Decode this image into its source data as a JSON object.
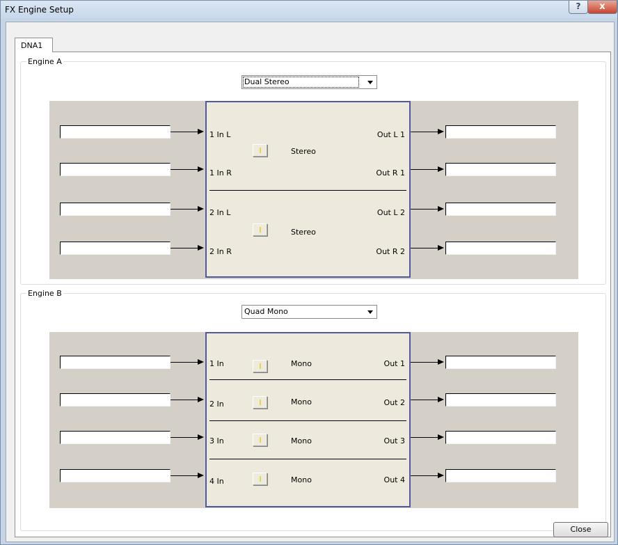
{
  "window": {
    "title": "FX Engine Setup",
    "help_symbol": "?",
    "close_symbol": "x"
  },
  "tabs": [
    {
      "label": "DNA1"
    }
  ],
  "engine_a": {
    "legend": "Engine A",
    "mode": "Dual Stereo",
    "groups": [
      {
        "type_label": "Stereo",
        "inputs": [
          {
            "label": "1 In L",
            "source": ""
          },
          {
            "label": "1 In R",
            "source": ""
          }
        ],
        "outputs": [
          {
            "label": "Out L 1",
            "dest": ""
          },
          {
            "label": "Out R 1",
            "dest": ""
          }
        ]
      },
      {
        "type_label": "Stereo",
        "inputs": [
          {
            "label": "2 In L",
            "source": ""
          },
          {
            "label": "2 In R",
            "source": ""
          }
        ],
        "outputs": [
          {
            "label": "Out L 2",
            "dest": ""
          },
          {
            "label": "Out R 2",
            "dest": ""
          }
        ]
      }
    ]
  },
  "engine_b": {
    "legend": "Engine B",
    "mode": "Quad Mono",
    "channels": [
      {
        "in_label": "1 In",
        "type_label": "Mono",
        "out_label": "Out 1",
        "source": "",
        "dest": ""
      },
      {
        "in_label": "2 In",
        "type_label": "Mono",
        "out_label": "Out 2",
        "source": "",
        "dest": ""
      },
      {
        "in_label": "3 In",
        "type_label": "Mono",
        "out_label": "Out 3",
        "source": "",
        "dest": ""
      },
      {
        "in_label": "4 In",
        "type_label": "Mono",
        "out_label": "Out 4",
        "source": "",
        "dest": ""
      }
    ]
  },
  "footer": {
    "close_label": "Close"
  },
  "icons": {
    "help": "help-icon",
    "close": "close-icon",
    "dropdown": "chevron-down-icon",
    "arrow": "arrow-right-icon"
  },
  "colors": {
    "engine_border": "#52589f",
    "engine_fill": "#ede9dc",
    "panel_grey": "#d4d0c8",
    "close_button": "#c8452f"
  }
}
